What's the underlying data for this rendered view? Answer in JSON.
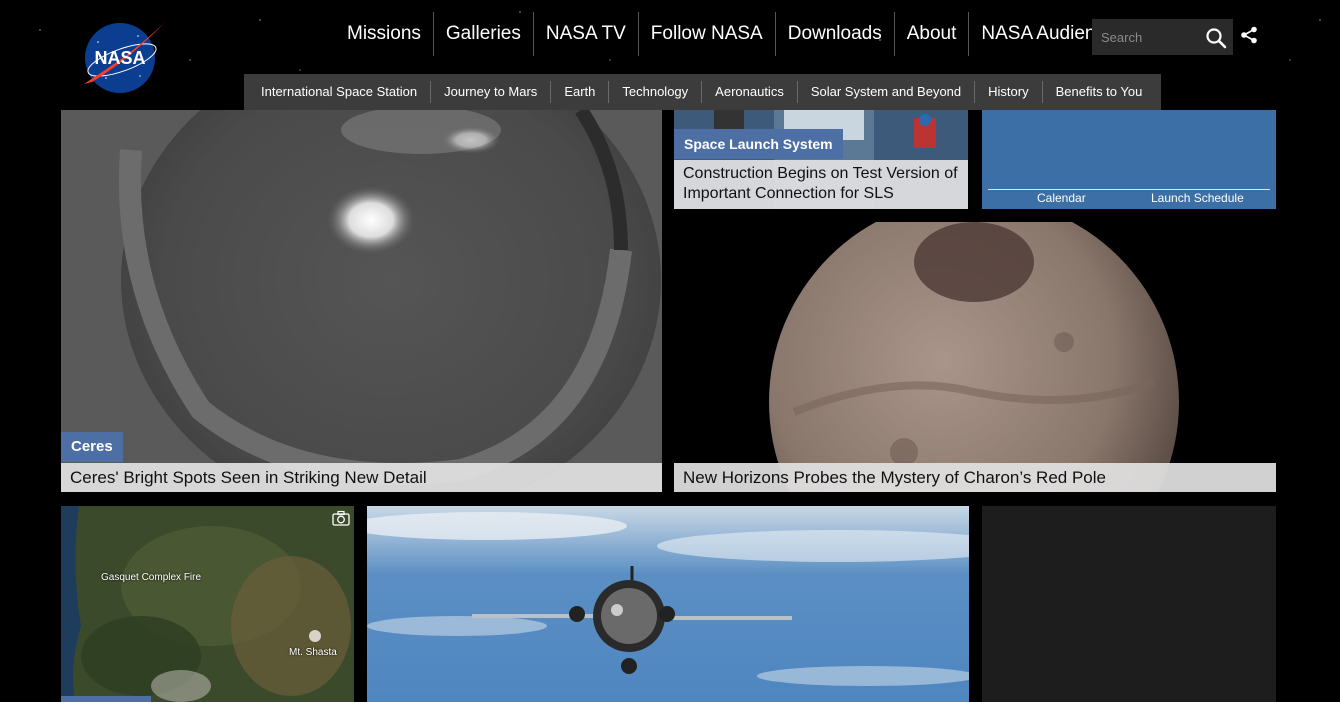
{
  "header": {
    "logo_text": "NASA",
    "main_nav": [
      "Missions",
      "Galleries",
      "NASA TV",
      "Follow NASA",
      "Downloads",
      "About",
      "NASA Audiences"
    ],
    "search_placeholder": "Search",
    "sub_nav": [
      "International Space Station",
      "Journey to Mars",
      "Earth",
      "Technology",
      "Aeronautics",
      "Solar System and Beyond",
      "History",
      "Benefits to You"
    ]
  },
  "cards": {
    "ceres": {
      "tag": "Ceres",
      "title": "Ceres' Bright Spots Seen in Striking New Detail"
    },
    "sls": {
      "tag": "Space Launch System",
      "title": "Construction Begins on Test Version of Important Connection for SLS"
    },
    "calendar": {
      "calendar_link": "Calendar",
      "launch_link": "Launch Schedule"
    },
    "charon": {
      "title": "New Horizons Probes the Mystery of Charon’s Red Pole"
    },
    "fire_map": {
      "labels": [
        "Gasquet Complex Fire",
        "Mt. Shasta"
      ],
      "icon": "camera-icon"
    },
    "soyuz": {},
    "dark_panel": {}
  },
  "colors": {
    "tag_blue": "#4d6fa3",
    "calendar_blue": "#3b6fa6",
    "subnav_bg": "#3c3c3c"
  }
}
